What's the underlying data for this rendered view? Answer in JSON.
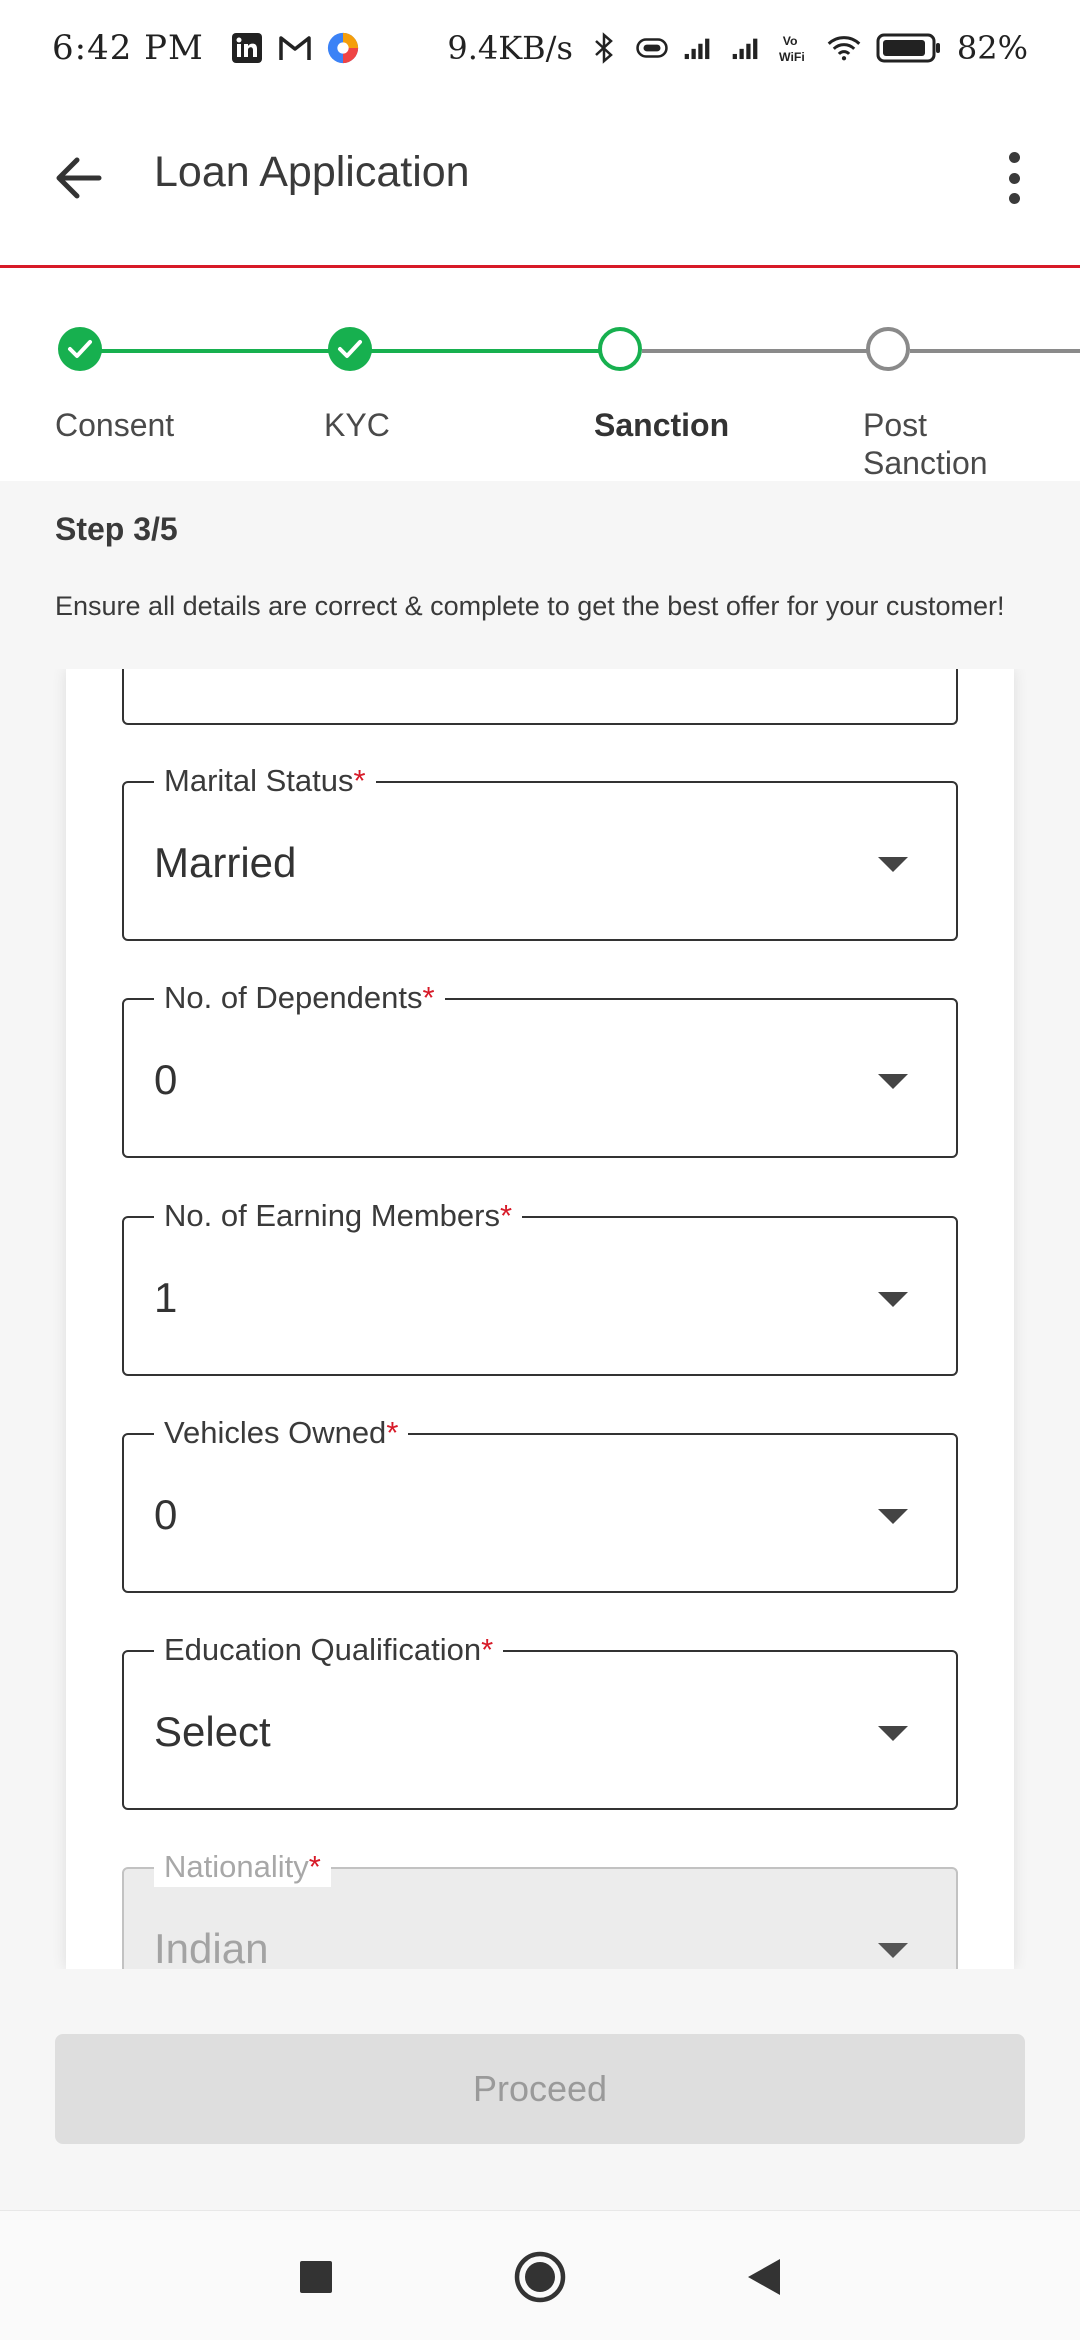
{
  "status_bar": {
    "time": "6:42 PM",
    "speed": "9.4KB/s",
    "battery": "82%",
    "icons": [
      "linkedin-icon",
      "gmail-icon",
      "app-icon",
      "bluetooth-icon",
      "vibrate-icon",
      "signal-icon",
      "signal-icon",
      "vowifi-icon",
      "wifi-icon",
      "battery-icon"
    ]
  },
  "app_bar": {
    "title": "Loan Application"
  },
  "stepper": {
    "steps": [
      {
        "label": "Consent",
        "state": "done"
      },
      {
        "label": "KYC",
        "state": "done"
      },
      {
        "label": "Sanction",
        "state": "current"
      },
      {
        "label": "Post Sanction",
        "state": "todo"
      }
    ],
    "colors": {
      "done": "#17b04f",
      "todo": "#8a8a8a"
    }
  },
  "step_info": {
    "step_no": "Step 3/5",
    "description": "Ensure all details are correct & complete to get the best offer for your customer!"
  },
  "form": {
    "fields": [
      {
        "label": "Marital Status",
        "required_mark": "*",
        "value": "Married"
      },
      {
        "label": "No. of Dependents",
        "required_mark": "*",
        "value": "0"
      },
      {
        "label": "No. of Earning Members",
        "required_mark": "*",
        "value": "1"
      },
      {
        "label": "Vehicles Owned",
        "required_mark": "*",
        "value": "0"
      },
      {
        "label": "Education Qualification",
        "required_mark": "*",
        "value": "Select"
      },
      {
        "label": "Nationality",
        "required_mark": "*",
        "value": "Indian",
        "disabled": true
      }
    ]
  },
  "actions": {
    "proceed_label": "Proceed"
  },
  "colors": {
    "accent": "#d71a28",
    "success": "#17b04f"
  }
}
